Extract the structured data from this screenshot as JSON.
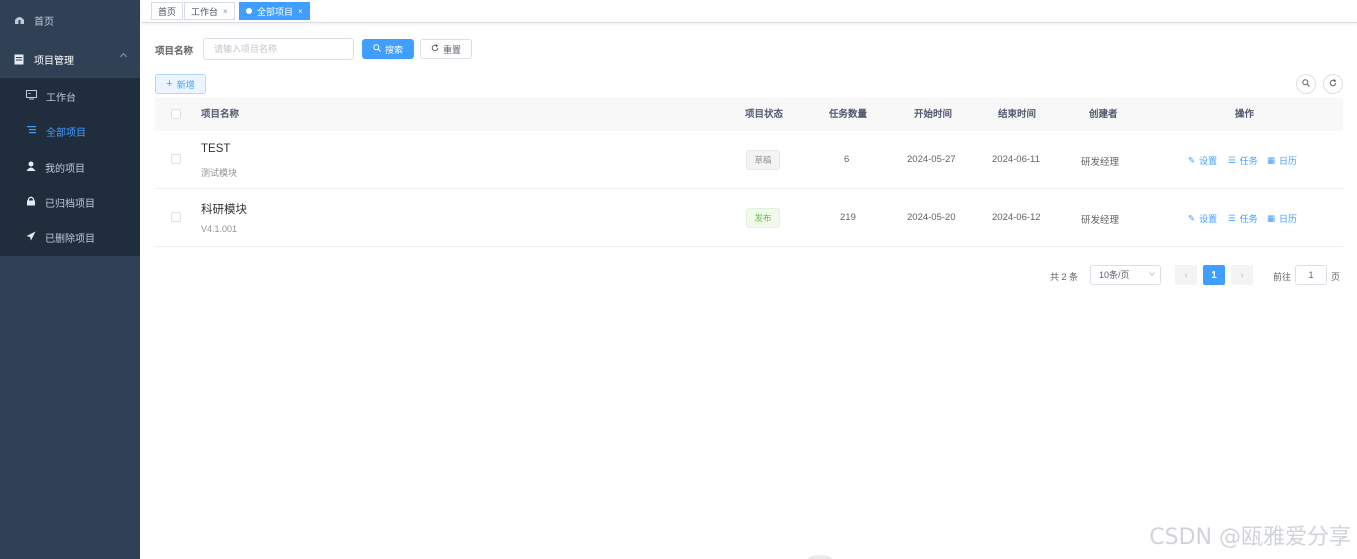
{
  "sidebar": {
    "items": [
      {
        "label": "首页",
        "icon": "dashboard-icon"
      },
      {
        "label": "项目管理",
        "icon": "document-icon"
      }
    ],
    "submenu": [
      {
        "label": "工作台",
        "icon": "monitor-icon",
        "active": false
      },
      {
        "label": "全部项目",
        "icon": "list-icon",
        "active": true
      },
      {
        "label": "我的项目",
        "icon": "user-icon",
        "active": false
      },
      {
        "label": "已归档项目",
        "icon": "lock-icon",
        "active": false
      },
      {
        "label": "已删除项目",
        "icon": "send-icon",
        "active": false
      }
    ]
  },
  "tags": [
    {
      "label": "首页",
      "closable": false,
      "active": false
    },
    {
      "label": "工作台",
      "closable": true,
      "active": false
    },
    {
      "label": "全部项目",
      "closable": true,
      "active": true
    }
  ],
  "search": {
    "label": "项目名称",
    "placeholder": "请输入项目名称",
    "search_button": "搜索",
    "reset_button": "重置"
  },
  "toolbar": {
    "add_button": "新增"
  },
  "table": {
    "columns": [
      "项目名称",
      "项目状态",
      "任务数量",
      "开始时间",
      "结束时间",
      "创建者",
      "操作"
    ],
    "rows": [
      {
        "name": "TEST",
        "sub": "测试模块",
        "status": "草稿",
        "status_type": "draft",
        "tasks": "6",
        "start": "2024-05-27",
        "end": "2024-06-11",
        "creator": "研发经理"
      },
      {
        "name": "科研模块",
        "sub": "V4.1.001",
        "status": "发布",
        "status_type": "published",
        "tasks": "219",
        "start": "2024-05-20",
        "end": "2024-06-12",
        "creator": "研发经理"
      }
    ],
    "actions": [
      "设置",
      "任务",
      "日历"
    ]
  },
  "pagination": {
    "total_text": "共 2 条",
    "page_size": "10条/页",
    "current_page": "1",
    "goto_label": "前往",
    "goto_value": "1",
    "unit": "页"
  },
  "watermark": "CSDN @瓯雅爱分享",
  "colors": {
    "primary": "#409eff",
    "sidebar": "#304156",
    "submenu": "#1f2d3d",
    "success": "#67c23a"
  }
}
